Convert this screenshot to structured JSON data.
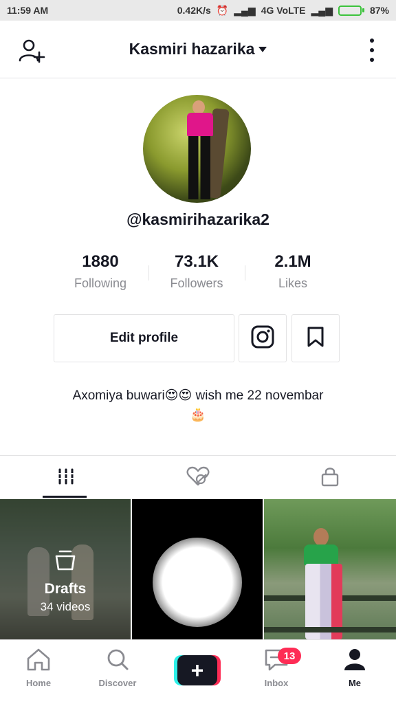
{
  "status_bar": {
    "time": "11:59 AM",
    "network_speed": "0.42K/s",
    "network_type": "4G VoLTE",
    "battery": "87%",
    "battery_level": 0.87
  },
  "header": {
    "title": "Kasmiri hazarika"
  },
  "profile": {
    "handle": "@kasmirihazarika2",
    "stats": [
      {
        "value": "1880",
        "label": "Following"
      },
      {
        "value": "73.1K",
        "label": "Followers"
      },
      {
        "value": "2.1M",
        "label": "Likes"
      }
    ],
    "edit_button": "Edit profile",
    "bio_line1": "Axomiya buwari😍😍 wish me 22 novembar",
    "bio_line2": "🎂"
  },
  "grid": {
    "drafts_title": "Drafts",
    "drafts_count": "34 videos"
  },
  "bottom_nav": {
    "home": "Home",
    "discover": "Discover",
    "create": "+",
    "inbox": "Inbox",
    "inbox_badge": "13",
    "me": "Me"
  },
  "colors": {
    "accent_red": "#fe2c55",
    "accent_cyan": "#2ef0e8",
    "text_primary": "#161823",
    "text_secondary": "#8a8b91"
  }
}
